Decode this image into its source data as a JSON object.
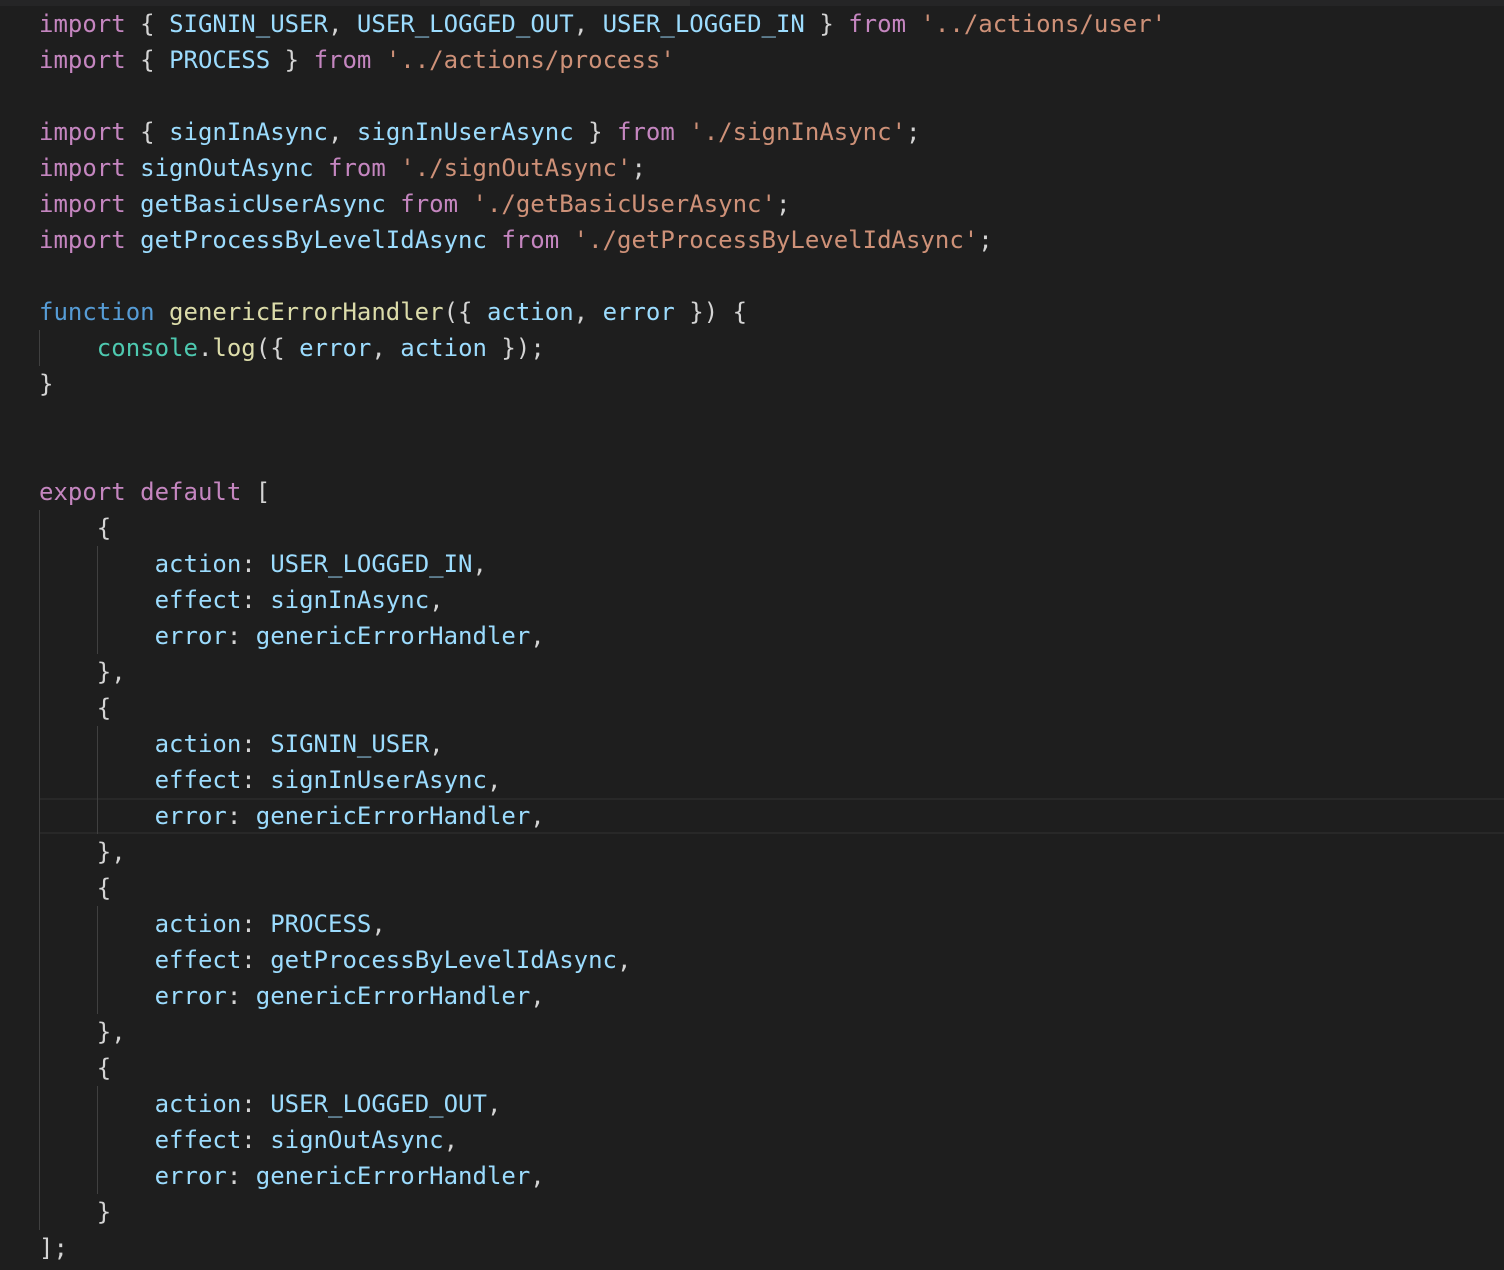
{
  "editor": {
    "language": "javascript",
    "theme": "dark",
    "active_line": 23,
    "colors": {
      "background": "#1e1e1e",
      "keyword_control": "#c586c0",
      "keyword_declaration": "#569cd6",
      "variable": "#9cdcfe",
      "string": "#ce9178",
      "function": "#dcdcaa",
      "class": "#4ec9b0",
      "punctuation": "#d4d4d4"
    },
    "lines": [
      [
        [
          "kw",
          "import"
        ],
        [
          "p",
          " { "
        ],
        [
          "v",
          "SIGNIN_USER"
        ],
        [
          "p",
          ", "
        ],
        [
          "v",
          "USER_LOGGED_OUT"
        ],
        [
          "p",
          ", "
        ],
        [
          "v",
          "USER_LOGGED_IN"
        ],
        [
          "p",
          " } "
        ],
        [
          "kw",
          "from"
        ],
        [
          "p",
          " "
        ],
        [
          "s",
          "'../actions/user'"
        ]
      ],
      [
        [
          "kw",
          "import"
        ],
        [
          "p",
          " { "
        ],
        [
          "v",
          "PROCESS"
        ],
        [
          "p",
          " } "
        ],
        [
          "kw",
          "from"
        ],
        [
          "p",
          " "
        ],
        [
          "s",
          "'../actions/process'"
        ]
      ],
      [],
      [
        [
          "kw",
          "import"
        ],
        [
          "p",
          " { "
        ],
        [
          "v",
          "signInAsync"
        ],
        [
          "p",
          ", "
        ],
        [
          "v",
          "signInUserAsync"
        ],
        [
          "p",
          " } "
        ],
        [
          "kw",
          "from"
        ],
        [
          "p",
          " "
        ],
        [
          "s",
          "'./signInAsync'"
        ],
        [
          "p",
          ";"
        ]
      ],
      [
        [
          "kw",
          "import"
        ],
        [
          "p",
          " "
        ],
        [
          "v",
          "signOutAsync"
        ],
        [
          "p",
          " "
        ],
        [
          "kw",
          "from"
        ],
        [
          "p",
          " "
        ],
        [
          "s",
          "'./signOutAsync'"
        ],
        [
          "p",
          ";"
        ]
      ],
      [
        [
          "kw",
          "import"
        ],
        [
          "p",
          " "
        ],
        [
          "v",
          "getBasicUserAsync"
        ],
        [
          "p",
          " "
        ],
        [
          "kw",
          "from"
        ],
        [
          "p",
          " "
        ],
        [
          "s",
          "'./getBasicUserAsync'"
        ],
        [
          "p",
          ";"
        ]
      ],
      [
        [
          "kw",
          "import"
        ],
        [
          "p",
          " "
        ],
        [
          "v",
          "getProcessByLevelIdAsync"
        ],
        [
          "p",
          " "
        ],
        [
          "kw",
          "from"
        ],
        [
          "p",
          " "
        ],
        [
          "s",
          "'./getProcessByLevelIdAsync'"
        ],
        [
          "p",
          ";"
        ]
      ],
      [],
      [
        [
          "decl",
          "function"
        ],
        [
          "p",
          " "
        ],
        [
          "fn",
          "genericErrorHandler"
        ],
        [
          "p",
          "({ "
        ],
        [
          "v",
          "action"
        ],
        [
          "p",
          ", "
        ],
        [
          "v",
          "error"
        ],
        [
          "p",
          " }) {"
        ]
      ],
      [
        [
          "p",
          "    "
        ],
        [
          "cls",
          "console"
        ],
        [
          "p",
          "."
        ],
        [
          "fn",
          "log"
        ],
        [
          "p",
          "({ "
        ],
        [
          "v",
          "error"
        ],
        [
          "p",
          ", "
        ],
        [
          "v",
          "action"
        ],
        [
          "p",
          " });"
        ]
      ],
      [
        [
          "p",
          "}"
        ]
      ],
      [],
      [],
      [
        [
          "kw",
          "export"
        ],
        [
          "p",
          " "
        ],
        [
          "kw",
          "default"
        ],
        [
          "p",
          " ["
        ]
      ],
      [
        [
          "p",
          "    {"
        ]
      ],
      [
        [
          "p",
          "        "
        ],
        [
          "v",
          "action"
        ],
        [
          "p",
          ": "
        ],
        [
          "v",
          "USER_LOGGED_IN"
        ],
        [
          "p",
          ","
        ]
      ],
      [
        [
          "p",
          "        "
        ],
        [
          "v",
          "effect"
        ],
        [
          "p",
          ": "
        ],
        [
          "v",
          "signInAsync"
        ],
        [
          "p",
          ","
        ]
      ],
      [
        [
          "p",
          "        "
        ],
        [
          "v",
          "error"
        ],
        [
          "p",
          ": "
        ],
        [
          "v",
          "genericErrorHandler"
        ],
        [
          "p",
          ","
        ]
      ],
      [
        [
          "p",
          "    },"
        ]
      ],
      [
        [
          "p",
          "    {"
        ]
      ],
      [
        [
          "p",
          "        "
        ],
        [
          "v",
          "action"
        ],
        [
          "p",
          ": "
        ],
        [
          "v",
          "SIGNIN_USER"
        ],
        [
          "p",
          ","
        ]
      ],
      [
        [
          "p",
          "        "
        ],
        [
          "v",
          "effect"
        ],
        [
          "p",
          ": "
        ],
        [
          "v",
          "signInUserAsync"
        ],
        [
          "p",
          ","
        ]
      ],
      [
        [
          "p",
          "        "
        ],
        [
          "v",
          "error"
        ],
        [
          "p",
          ": "
        ],
        [
          "v",
          "genericErrorHandler"
        ],
        [
          "p",
          ","
        ]
      ],
      [
        [
          "p",
          "    },"
        ]
      ],
      [
        [
          "p",
          "    {"
        ]
      ],
      [
        [
          "p",
          "        "
        ],
        [
          "v",
          "action"
        ],
        [
          "p",
          ": "
        ],
        [
          "v",
          "PROCESS"
        ],
        [
          "p",
          ","
        ]
      ],
      [
        [
          "p",
          "        "
        ],
        [
          "v",
          "effect"
        ],
        [
          "p",
          ": "
        ],
        [
          "v",
          "getProcessByLevelIdAsync"
        ],
        [
          "p",
          ","
        ]
      ],
      [
        [
          "p",
          "        "
        ],
        [
          "v",
          "error"
        ],
        [
          "p",
          ": "
        ],
        [
          "v",
          "genericErrorHandler"
        ],
        [
          "p",
          ","
        ]
      ],
      [
        [
          "p",
          "    },"
        ]
      ],
      [
        [
          "p",
          "    {"
        ]
      ],
      [
        [
          "p",
          "        "
        ],
        [
          "v",
          "action"
        ],
        [
          "p",
          ": "
        ],
        [
          "v",
          "USER_LOGGED_OUT"
        ],
        [
          "p",
          ","
        ]
      ],
      [
        [
          "p",
          "        "
        ],
        [
          "v",
          "effect"
        ],
        [
          "p",
          ": "
        ],
        [
          "v",
          "signOutAsync"
        ],
        [
          "p",
          ","
        ]
      ],
      [
        [
          "p",
          "        "
        ],
        [
          "v",
          "error"
        ],
        [
          "p",
          ": "
        ],
        [
          "v",
          "genericErrorHandler"
        ],
        [
          "p",
          ","
        ]
      ],
      [
        [
          "p",
          "    }"
        ]
      ],
      [
        [
          "p",
          "];"
        ]
      ]
    ]
  }
}
